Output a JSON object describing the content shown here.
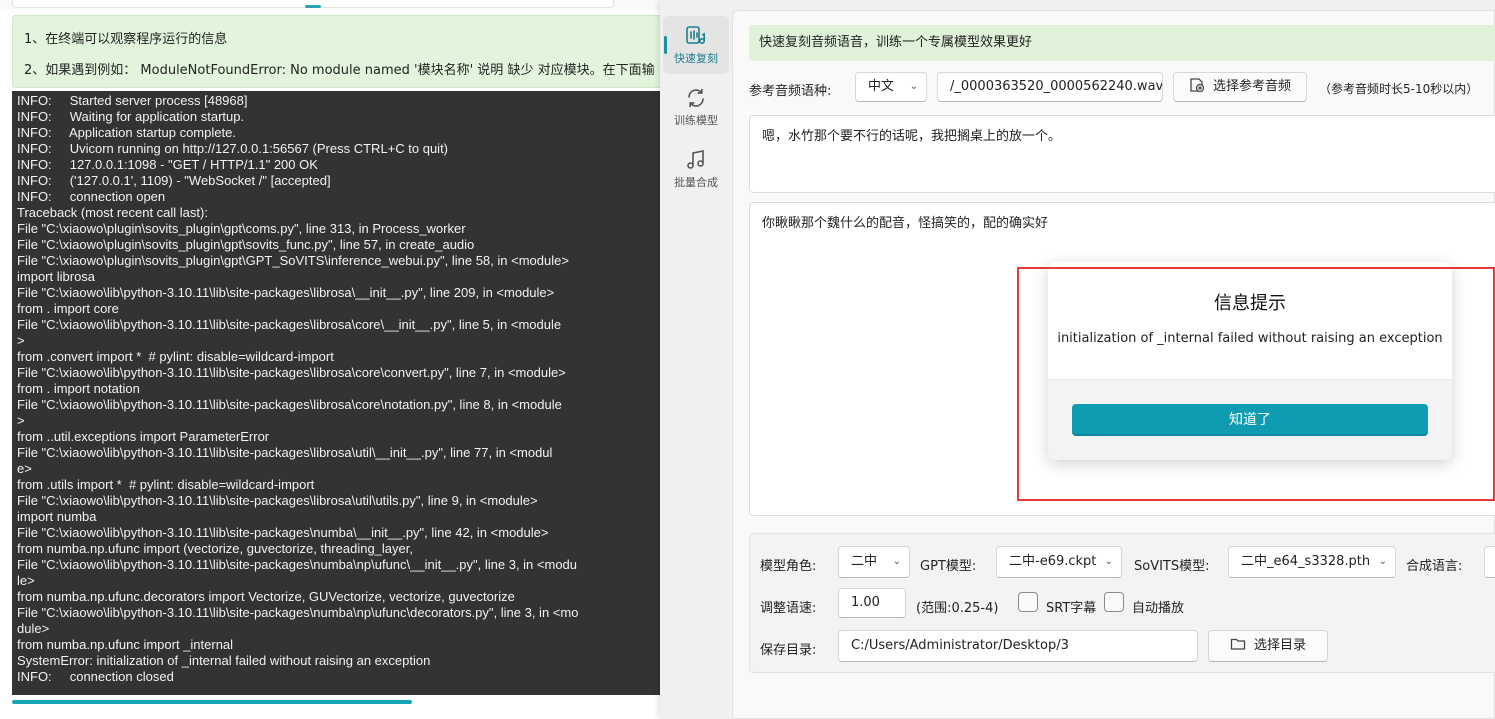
{
  "hints": {
    "line1": "1、在终端可以观察程序运行的信息",
    "line2": "2、如果遇到例如： ModuleNotFoundError: No module named '模块名称' 说明 缺少 对应模块。在下面输"
  },
  "terminal_lines": [
    "INFO:     Started server process [48968]",
    "INFO:     Waiting for application startup.",
    "INFO:     Application startup complete.",
    "INFO:     Uvicorn running on http://127.0.0.1:56567 (Press CTRL+C to quit)",
    "INFO:     127.0.0.1:1098 - \"GET / HTTP/1.1\" 200 OK",
    "INFO:     ('127.0.0.1', 1109) - \"WebSocket /\" [accepted]",
    "INFO:     connection open",
    "Traceback (most recent call last):",
    "File \"C:\\xiaowo\\plugin\\sovits_plugin\\gpt\\coms.py\", line 313, in Process_worker",
    "File \"C:\\xiaowo\\plugin\\sovits_plugin\\gpt\\sovits_func.py\", line 57, in create_audio",
    "File \"C:\\xiaowo\\plugin\\sovits_plugin\\gpt\\GPT_SoVITS\\inference_webui.py\", line 58, in <module>",
    "import librosa",
    "File \"C:\\xiaowo\\lib\\python-3.10.11\\lib\\site-packages\\librosa\\__init__.py\", line 209, in <module>",
    "from . import core",
    "File \"C:\\xiaowo\\lib\\python-3.10.11\\lib\\site-packages\\librosa\\core\\__init__.py\", line 5, in <module",
    ">",
    "from .convert import *  # pylint: disable=wildcard-import",
    "File \"C:\\xiaowo\\lib\\python-3.10.11\\lib\\site-packages\\librosa\\core\\convert.py\", line 7, in <module>",
    "from . import notation",
    "File \"C:\\xiaowo\\lib\\python-3.10.11\\lib\\site-packages\\librosa\\core\\notation.py\", line 8, in <module",
    ">",
    "from ..util.exceptions import ParameterError",
    "File \"C:\\xiaowo\\lib\\python-3.10.11\\lib\\site-packages\\librosa\\util\\__init__.py\", line 77, in <modul",
    "e>",
    "from .utils import *  # pylint: disable=wildcard-import",
    "File \"C:\\xiaowo\\lib\\python-3.10.11\\lib\\site-packages\\librosa\\util\\utils.py\", line 9, in <module>",
    "import numba",
    "File \"C:\\xiaowo\\lib\\python-3.10.11\\lib\\site-packages\\numba\\__init__.py\", line 42, in <module>",
    "from numba.np.ufunc import (vectorize, guvectorize, threading_layer,",
    "File \"C:\\xiaowo\\lib\\python-3.10.11\\lib\\site-packages\\numba\\np\\ufunc\\__init__.py\", line 3, in <modu",
    "le>",
    "from numba.np.ufunc.decorators import Vectorize, GUVectorize, vectorize, guvectorize",
    "File \"C:\\xiaowo\\lib\\python-3.10.11\\lib\\site-packages\\numba\\np\\ufunc\\decorators.py\", line 3, in <mo",
    "dule>",
    "from numba.np.ufunc import _internal",
    "SystemError: initialization of _internal failed without raising an exception",
    "INFO:     connection closed"
  ],
  "nav": {
    "items": [
      {
        "label": "快速复刻",
        "icon": "audio-clone-icon",
        "active": true
      },
      {
        "label": "训练模型",
        "icon": "refresh-icon",
        "active": false
      },
      {
        "label": "批量合成",
        "icon": "music-note-icon",
        "active": false
      }
    ]
  },
  "banner": "快速复刻音频语音，训练一个专属模型效果更好",
  "reference": {
    "lang_label": "参考音频语种:",
    "lang_value": "中文",
    "file_value": "/_0000363520_0000562240.wav",
    "choose_button": "选择参考音频",
    "hint": "（参考音频时长5-10秒以内）"
  },
  "reference_text": "嗯，水竹那个要不行的话呢，我把搁桌上的放一个。",
  "synth_text": "你瞅瞅那个魏什么的配音，怪搞笑的，配的确实好",
  "settings": {
    "role_label": "模型角色:",
    "role_value": "二中",
    "gpt_label": "GPT模型:",
    "gpt_value": "二中-e69.ckpt",
    "sovits_label": "SoVITS模型:",
    "sovits_value": "二中_e64_s3328.pth",
    "synth_lang_label": "合成语言:",
    "speed_label": "调整语速:",
    "speed_value": "1.00",
    "speed_range": "(范围:0.25-4)",
    "srt_label": "SRT字幕",
    "autoplay_label": "自动播放",
    "dir_label": "保存目录:",
    "dir_value": "C:/Users/Administrator/Desktop/3",
    "choose_dir_button": "选择目录"
  },
  "dialog": {
    "title": "信息提示",
    "message": "initialization of _internal failed without raising an exception",
    "ok_button": "知道了"
  },
  "colors": {
    "accent": "#0f9bb0",
    "terminal_bg": "#333333",
    "hint_bg": "#e2f5dc",
    "highlight": "#e03b3b"
  }
}
